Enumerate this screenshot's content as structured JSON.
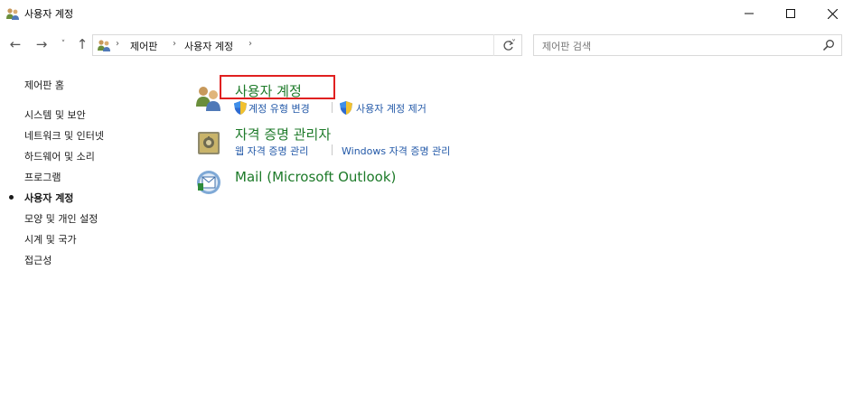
{
  "window": {
    "title": "사용자 계정"
  },
  "nav": {
    "back": "←",
    "forward": "→",
    "recent": "˅",
    "up": "↑"
  },
  "address": {
    "crumbs": [
      "제어판",
      "사용자 계정"
    ]
  },
  "search": {
    "placeholder": "제어판 검색"
  },
  "sidebar": {
    "items": [
      {
        "label": "제어판 홈"
      },
      {
        "label": "시스템 및 보안"
      },
      {
        "label": "네트워크 및 인터넷"
      },
      {
        "label": "하드웨어 및 소리"
      },
      {
        "label": "프로그램"
      },
      {
        "label": "사용자 계정",
        "current": true
      },
      {
        "label": "모양 및 개인 설정"
      },
      {
        "label": "시계 및 국가"
      },
      {
        "label": "접근성"
      }
    ]
  },
  "categories": [
    {
      "title": "사용자 계정",
      "links": [
        "계정 유형 변경",
        "사용자 계정 제거"
      ],
      "icon": "users-icon"
    },
    {
      "title": "자격 증명 관리자",
      "links": [
        "웹 자격 증명 관리",
        "Windows 자격 증명 관리"
      ],
      "icon": "credential-vault-icon"
    },
    {
      "title": "Mail (Microsoft Outlook)",
      "links": [],
      "icon": "mail-icon"
    }
  ],
  "colors": {
    "category_title": "#1d7a29",
    "link": "#2359a8",
    "highlight": "#e02020"
  }
}
